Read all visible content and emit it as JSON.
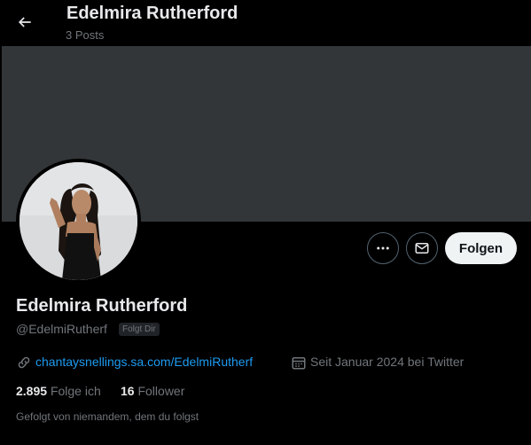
{
  "header": {
    "back_icon": "arrow-left-icon",
    "title": "Edelmira Rutherford",
    "posts_count": "3 Posts"
  },
  "colors": {
    "background": "#000000",
    "banner": "#333639",
    "link": "#1d9bf0",
    "secondary_text": "#71767b",
    "follow_button_bg": "#eff3f4"
  },
  "actions": {
    "more_icon": "more-horizontal-icon",
    "message_icon": "envelope-icon",
    "follow_label": "Folgen"
  },
  "profile": {
    "name": "Edelmira Rutherford",
    "handle": "@EdelmiRutherf",
    "follows_you_badge": "Folgt Dir",
    "link_icon": "link-icon",
    "website": "chantaysnellings.sa.com/EdelmiRutherf",
    "calendar_icon": "calendar-icon",
    "joined": "Seit Januar 2024 bei Twitter",
    "following_count": "2.895",
    "following_label": "Folge ich",
    "followers_count": "16",
    "followers_label": "Follower",
    "followed_by": "Gefolgt von niemandem, dem du folgst"
  }
}
